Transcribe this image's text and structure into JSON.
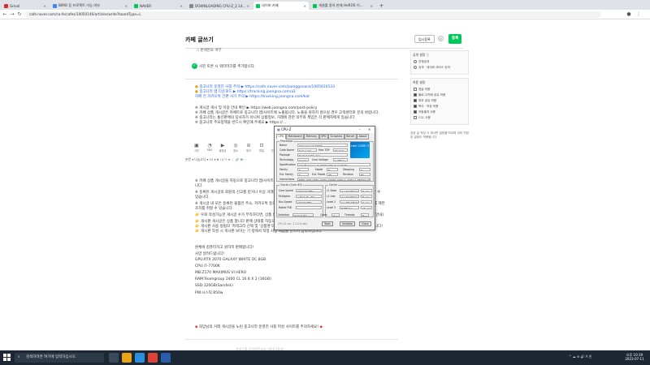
{
  "browser": {
    "tabs": [
      {
        "label": "Gmail",
        "color": "#d93025"
      },
      {
        "label": "BIMO 등 프로젝트 가능 여부",
        "color": "#4285f4"
      },
      {
        "label": "NAVER",
        "color": "#03c75a"
      },
      {
        "label": "DOWNLOADING CPU-Z_2.14...",
        "color": "#888888"
      },
      {
        "label": "네이버 카페",
        "color": "#03c75a",
        "active": true
      },
      {
        "label": "개설를 종의 판매 HeROS 이...",
        "color": "#03c75a"
      }
    ],
    "url": "cafe.naver.com/ca-fe/cafes/10050146/articles/write?boardType=L"
  },
  "editor": {
    "title": "카페 글쓰기",
    "temp_save_label": "임시등록",
    "temp_count": "0",
    "register_label": "등록"
  },
  "content": {
    "line_top": "판매완료 여부",
    "auto_caption": "사진 토론 시 워터마크를 추가합니다.",
    "info_lines": [
      "중고나라 운영진 사칭 주의 ▶ https://cafe.naver.com/joonggonara/1005610533",
      "중고나라 앱 다운로드 ▶ https://tracking.joongna.com/a1",
      "카페 안 카카오톡 간편 사기 주의 ▶ https://tracking.joongna.com/kat",
      "",
      "※ 게시글 게시 및 이용 안내 확인 ▶ https://web.joongna.com/post-policy",
      "※ 카페 상품 게시글은 카페트로 중고나라 앱/사이트에 노출됩니다. 노출을 원하지 않으실 경우 고객센터로 문의 바랍니다.",
      "※ 중고나라는 통신판매의 당사자가 아니며 상품정보, 거래에 관한 의무와 책임은 각 판매자에게 있습니다.",
      "※ 중고나라 주요정책을 반드시 확인해 주세요 ▶ https://..."
    ],
    "body_lines": [
      "※ 카페 상품 게시글을 자동으로 중고나라 앱/사이트에 노출됩니다. 노출을 원하지 않으실 경우 고객센터로 문의 바랍",
      "니다.",
      "※ 등록된 게시글의 회원의 신고를 받거나 이상 거래 모니터링 시스템에 의해 노출될 경우 사기 피해 방지를 위해 이용할 수",
      "있습니다.",
      "※ 게시글 내 모든 등록된 물품은 주소, 카카오톡 등의 외부 채팅 등으로 유도하는 경우 안전거래를 권유하여 사기 피해를 제한",
      "조치를 취할 수 있습니다.",
      "우회 작성가능한 게시글 수가 부족하다면, 상품 등록 전 중고나라 앱/사이트에서 게시글 작성 상태를 확인해 주세요(안내)",
      "게시판 게시글은 상품 팝니다 판매 상태를 자동으로 반영하지 않습니다.",
      "게시판 사용 방법의 '카테고리 선택 및 '상품명'의 '판매' 특이 목록을 1분마다 적용에서 적정 상태 시에 반영 가능합니다!",
      "게시판 작성 시 게시판 보이는 기 정에서 적정 사항 제품을 반드시 입력하십니다."
    ],
    "sale_lines": [
      "본체에 컴퓨터하고 원하지 판매합니다!",
      "사양 알려드립니다!",
      "GPU:RTX 2070 GALAXY WHITE OC 8GB",
      "CPU:i7-7700K",
      "MB:Z170 MAXIMUS VI HERO",
      "RAM:Teamgroup 2400 CL 16 8 X 2 (16GB)",
      "SSD:120GB(Sandisk)",
      "PW:시스틱 850w"
    ],
    "footer_warning": "희망님의 거래 게시글을 노린 중고나라 운영진 사칭 피싱 사이트를 주의하세요!",
    "bottom_faint": "#태그를 입력해주세요 (최대 10개)"
  },
  "toolbar": {
    "icons": [
      {
        "name": "photo-icon",
        "glyph": "▣",
        "label": "사진"
      },
      {
        "name": "sticker-icon",
        "glyph": "◔",
        "label": "SNS"
      },
      {
        "name": "video-icon",
        "glyph": "▶",
        "label": "동영상"
      },
      {
        "name": "place-icon",
        "glyph": "◎",
        "label": "장소"
      },
      {
        "name": "link-icon",
        "glyph": "⊘",
        "label": "링크"
      },
      {
        "name": "file-icon",
        "glyph": "⊡",
        "label": "파일"
      },
      {
        "name": "quote-icon",
        "glyph": "❝",
        "label": "인용구"
      },
      {
        "name": "line-icon",
        "glyph": "—",
        "label": "구분선"
      },
      {
        "name": "schedule-icon",
        "glyph": "▤",
        "label": "일정"
      },
      {
        "name": "table-icon",
        "glyph": "⊞",
        "label": "표"
      },
      {
        "name": "code-icon",
        "glyph": "≡",
        "label": "코드"
      },
      {
        "name": "vote-icon",
        "glyph": "◫",
        "label": "투표"
      },
      {
        "name": "draw-icon",
        "glyph": "✎",
        "label": "그리기"
      }
    ],
    "format_row": "본문  ▾   나눔고딕 ▾   15  ▾   B   I   U   T   ≡  ⋮  🔗  ⊞  ⋯"
  },
  "sidebar": {
    "public_title": "공개 설정 ⓘ",
    "public_options": [
      "전체공개",
      "검색 · 네이버 서비스 공개"
    ],
    "allow_title": "허용 설정",
    "allow_options": [
      {
        "label": "댓글 허용",
        "checked": false
      },
      {
        "label": "블로그/카페 공유 허용",
        "checked": true
      },
      {
        "label": "외부 공유 허용",
        "checked": true
      },
      {
        "label": "복사 · 저장 허용",
        "checked": true
      },
      {
        "label": "자동출처 사용",
        "checked": true
      },
      {
        "label": "CCL 사용",
        "checked": false
      }
    ],
    "note": "공공 글 작성 시 게시판 설정을 따르며 이미 지정된 설정이 적용됩니다."
  },
  "cpuz": {
    "title": "CPU-Z",
    "tabs": [
      "CPU",
      "Mainboard",
      "Memory",
      "SPD",
      "Graphics",
      "Bench",
      "About"
    ],
    "processor_label": "Processor",
    "name_label": "Name",
    "name": "Intel Core i7 7700K",
    "code_label": "Code Name",
    "code": "Kaby Lake",
    "tdp_label": "Max TDP",
    "tdp": "91.0 W",
    "package_label": "Package",
    "package": "Socket 1151 LGA",
    "tech_label": "Technology",
    "tech": "14 nm",
    "volt_label": "Core Voltage",
    "volt": "1.280 V",
    "spec_label": "Specification",
    "spec": "Intel® Core™ i7-7700K CPU @ 4.20GHz",
    "family_label": "Family",
    "family": "6",
    "model_label": "Model",
    "model": "E",
    "stepping_label": "Stepping",
    "stepping": "9",
    "extfam_label": "Ext. Family",
    "extfam": "6",
    "extmod_label": "Ext. Model",
    "extmod": "9E",
    "rev_label": "Revision",
    "rev": "B0",
    "instr_label": "Instructions",
    "instr": "MMX, SSE, SSE2, SSE3, SSSE3, SSE4.1, SSE4.2, EM64T, VT-x, AES, AVX, AVX2, FMA3, TSX",
    "clocks_label": "Clocks (Core #0)",
    "cspeed_label": "Core Speed",
    "cspeed": "5000.00 MHz",
    "mult_label": "Multiplier",
    "mult": "x 50.0 (8 - 50)",
    "bus_label": "Bus Speed",
    "bus": "100.00 MHz",
    "fsb_label": "Rated FSB",
    "fsb": "",
    "cache_label": "Cache",
    "l1d_label": "L1 Data",
    "l1d": "4 x 32 KBytes",
    "l1d_way": "8-way",
    "l1i_label": "L1 Inst.",
    "l1i": "4 x 32 KBytes",
    "l1i_way": "8-way",
    "l2_label": "Level 2",
    "l2": "4 x 256 KBytes",
    "l2_way": "4-way",
    "l3_label": "Level 3",
    "l3": "8 MBytes",
    "l3_way": "16-way",
    "sel_label": "Selection",
    "sel": "Socket #1",
    "cores_label": "Cores",
    "cores": "4",
    "threads_label": "Threads",
    "threads": "8",
    "ver": "CPU-Z   ver. 2.14.0.x64",
    "tools": "Tools",
    "validate": "Validate",
    "close": "Close",
    "logo_text": "intel CORE i7"
  },
  "taskbar": {
    "search_placeholder": "검색하려면 여기에 입력하십시오.",
    "tray": "^  ☁  ⊕  🔊  A  한",
    "time": "오후 10:19",
    "date": "2023-07-11"
  }
}
